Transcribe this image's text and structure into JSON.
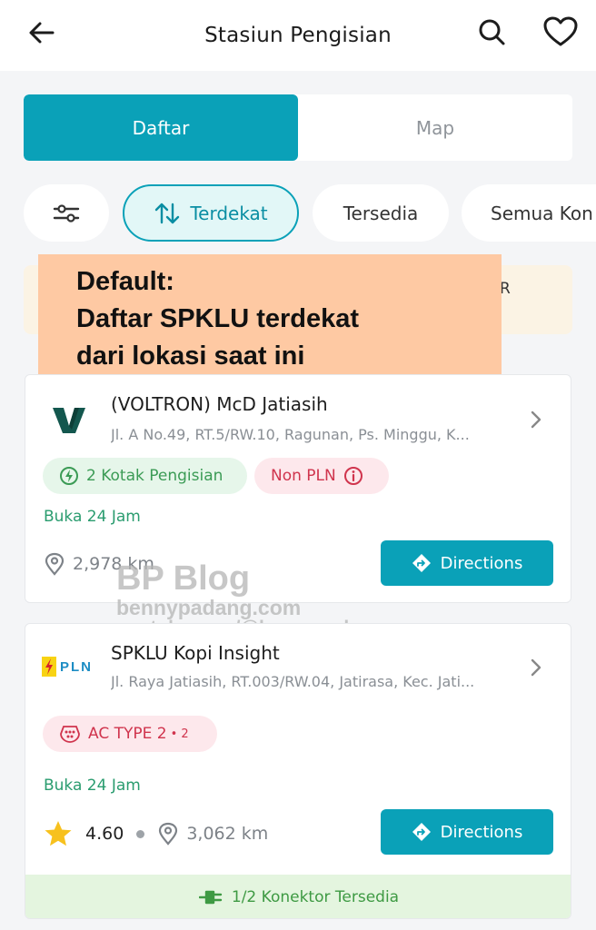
{
  "header": {
    "title": "Stasiun Pengisian"
  },
  "segments": {
    "list_label": "Daftar",
    "map_label": "Map"
  },
  "chips": {
    "nearest": "Terdekat",
    "available": "Tersedia",
    "all_connectors": "Semua Kon"
  },
  "banner": {
    "tail": "R"
  },
  "annotation": {
    "line1": "Default:",
    "line2": "Daftar SPKLU terdekat",
    "line3": "dari lokasi saat ini"
  },
  "watermark": {
    "line1": "BP Blog",
    "line2": "bennypadang.com",
    "line3": "youtube.com/@bennypadang"
  },
  "stations": [
    {
      "name": "(VOLTRON) McD Jatiasih",
      "address": "Jl. A No.49, RT.5/RW.10, Ragunan, Ps. Minggu, K...",
      "badge_charging": "2 Kotak Pengisian",
      "badge_network": "Non PLN",
      "hours": "Buka 24 Jam",
      "distance": "2,978 km",
      "directions": "Directions"
    },
    {
      "name": "SPKLU Kopi Insight",
      "address": "Jl. Raya Jatiasih, RT.003/RW.04, Jatirasa, Kec. Jati...",
      "logo_text": "PLN",
      "badge_connector": "AC TYPE 2",
      "badge_connector_count": "• 2",
      "hours": "Buka 24 Jam",
      "rating": "4.60",
      "distance": "3,062 km",
      "directions": "Directions",
      "availability": "1/2 Konektor Tersedia"
    }
  ],
  "colors": {
    "accent": "#0aa1b8",
    "annotation_bg": "#fec9a3",
    "open_green": "#2a9c6f",
    "non_pln_red": "#d0344d"
  }
}
